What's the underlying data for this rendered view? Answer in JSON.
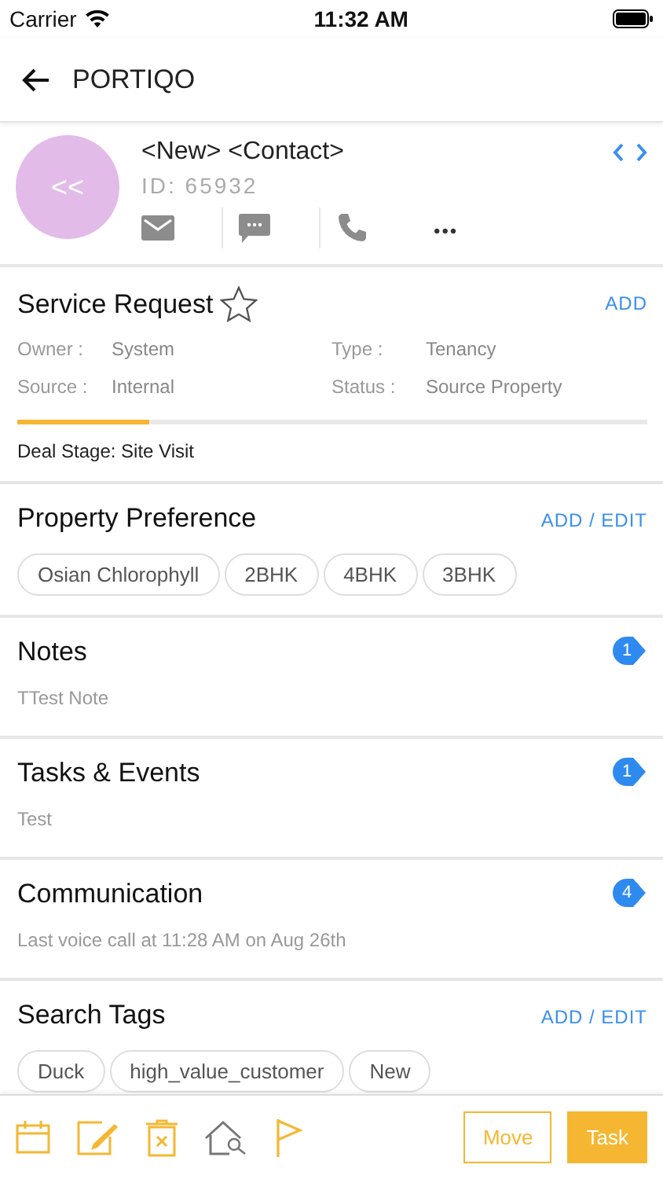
{
  "status_bar": {
    "carrier": "Carrier",
    "time": "11:32 AM"
  },
  "nav": {
    "title": "PORTIQO"
  },
  "contact": {
    "avatar_text": "<<",
    "name": "<New> <Contact>",
    "id": "ID: 65932",
    "more": "•••"
  },
  "sections": [
    {
      "kind": "service",
      "title": "Service Request",
      "starred": false,
      "action": "ADD",
      "fields": [
        {
          "label": "Owner :",
          "value": "System"
        },
        {
          "label": "Type :",
          "value": "Tenancy"
        },
        {
          "label": "Source :",
          "value": "Internal"
        },
        {
          "label": "Status :",
          "value": "Source Property"
        }
      ],
      "level": 0.21,
      "stage": "Deal Stage: Site Visit"
    },
    {
      "kind": "chips",
      "title": "Property Preference",
      "action": "ADD / EDIT",
      "chips": [
        "Osian Chlorophyll",
        "2BHK",
        "4BHK",
        "3BHK"
      ]
    },
    {
      "kind": "note",
      "title": "Notes",
      "count": "1",
      "text": "TTest Note"
    },
    {
      "kind": "note",
      "title": "Tasks & Events",
      "count": "1",
      "text": "Test"
    },
    {
      "kind": "note",
      "title": "Communication",
      "count": "4",
      "text": "Last voice call at 11:28 AM on Aug 26th"
    },
    {
      "kind": "chips",
      "title": "Search Tags",
      "action": "ADD / EDIT",
      "chips": [
        "Duck",
        "high_value_customer",
        "New"
      ]
    }
  ],
  "buttons": [
    {
      "label": "Move",
      "kind": "outline"
    },
    {
      "label": "Task",
      "kind": "filled"
    }
  ]
}
